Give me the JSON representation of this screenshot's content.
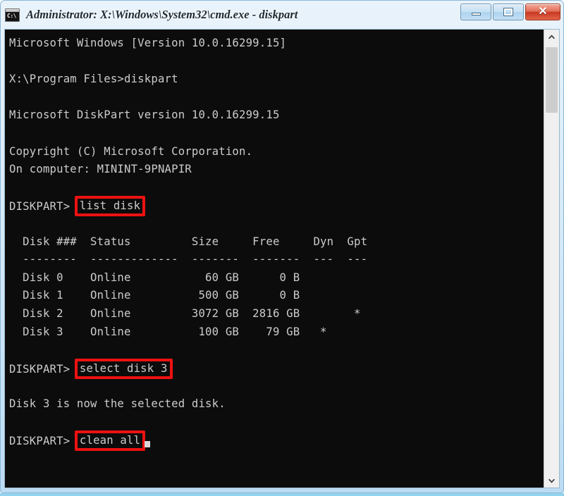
{
  "window": {
    "title": "Administrator: X:\\Windows\\System32\\cmd.exe - diskpart",
    "icon_name": "cmd-console-icon",
    "icon_label": "C:\\",
    "controls": {
      "minimize_label": "–",
      "maximize_label": "□",
      "close_label": "✕"
    },
    "frame_color": "#bcdcf3",
    "accent_close_color": "#c83a23"
  },
  "console": {
    "background_color": "#0c0c0c",
    "text_color": "#cccccc",
    "highlight_color": "#ee1111",
    "lines": [
      {
        "text": "Microsoft Windows [Version 10.0.16299.15]"
      },
      {
        "text": ""
      },
      {
        "text": "X:\\Program Files>diskpart"
      },
      {
        "text": ""
      },
      {
        "text": "Microsoft DiskPart version 10.0.16299.15"
      },
      {
        "text": ""
      },
      {
        "text": "Copyright (C) Microsoft Corporation."
      },
      {
        "text": "On computer: MININT-9PNAPIR"
      },
      {
        "text": ""
      },
      {
        "prompt": "DISKPART> ",
        "command": "list disk",
        "highlighted": true
      },
      {
        "text": ""
      },
      {
        "text": "  Disk ###  Status         Size     Free     Dyn  Gpt"
      },
      {
        "text": "  --------  -------------  -------  -------  ---  ---"
      },
      {
        "text": "  Disk 0    Online           60 GB      0 B"
      },
      {
        "text": "  Disk 1    Online          500 GB      0 B"
      },
      {
        "text": "  Disk 2    Online         3072 GB  2816 GB        *"
      },
      {
        "text": "  Disk 3    Online          100 GB    79 GB   *"
      },
      {
        "text": ""
      },
      {
        "prompt": "DISKPART> ",
        "command": "select disk 3",
        "highlighted": true
      },
      {
        "text": ""
      },
      {
        "text": "Disk 3 is now the selected disk."
      },
      {
        "text": ""
      },
      {
        "prompt": "DISKPART> ",
        "command": "clean all",
        "highlighted": true,
        "cursor": true
      }
    ]
  },
  "disk_table": {
    "headers": [
      "Disk ###",
      "Status",
      "Size",
      "Free",
      "Dyn",
      "Gpt"
    ],
    "rows": [
      {
        "disk": "Disk 0",
        "status": "Online",
        "size": "60 GB",
        "free": "0 B",
        "dyn": "",
        "gpt": ""
      },
      {
        "disk": "Disk 1",
        "status": "Online",
        "size": "500 GB",
        "free": "0 B",
        "dyn": "",
        "gpt": ""
      },
      {
        "disk": "Disk 2",
        "status": "Online",
        "size": "3072 GB",
        "free": "2816 GB",
        "dyn": "",
        "gpt": "*"
      },
      {
        "disk": "Disk 3",
        "status": "Online",
        "size": "100 GB",
        "free": "79 GB",
        "dyn": "*",
        "gpt": ""
      }
    ]
  },
  "scrollbar": {
    "up_arrow_name": "chevron-up-icon",
    "down_arrow_name": "chevron-down-icon",
    "thumb_position": "top"
  }
}
